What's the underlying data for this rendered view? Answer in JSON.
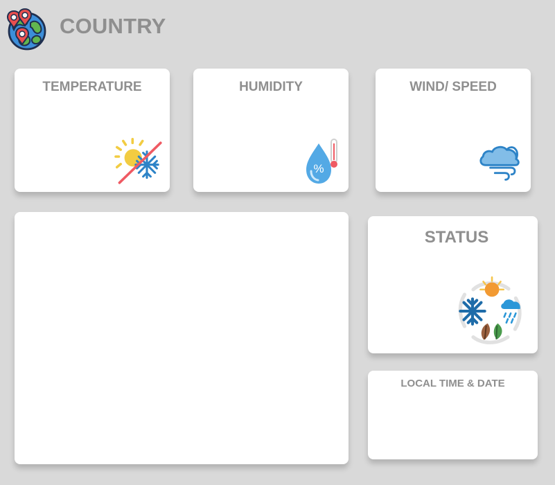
{
  "header": {
    "title": "COUNTRY",
    "logo_icon": "globe-pins-icon"
  },
  "cards": {
    "temperature": {
      "label": "TEMPERATURE",
      "icon": "sun-snowflake-icon"
    },
    "humidity": {
      "label": "HUMIDITY",
      "icon": "water-drop-thermometer-icon"
    },
    "wind": {
      "label": "WIND/ SPEED",
      "icon": "cloud-wind-icon"
    },
    "status": {
      "label": "STATUS",
      "icon": "weather-seasons-icon"
    },
    "local_time": {
      "label": "LOCAL TIME & DATE"
    }
  },
  "colors": {
    "background": "#d9d9d9",
    "card_background": "#ffffff",
    "label": "#8f8f8f"
  }
}
